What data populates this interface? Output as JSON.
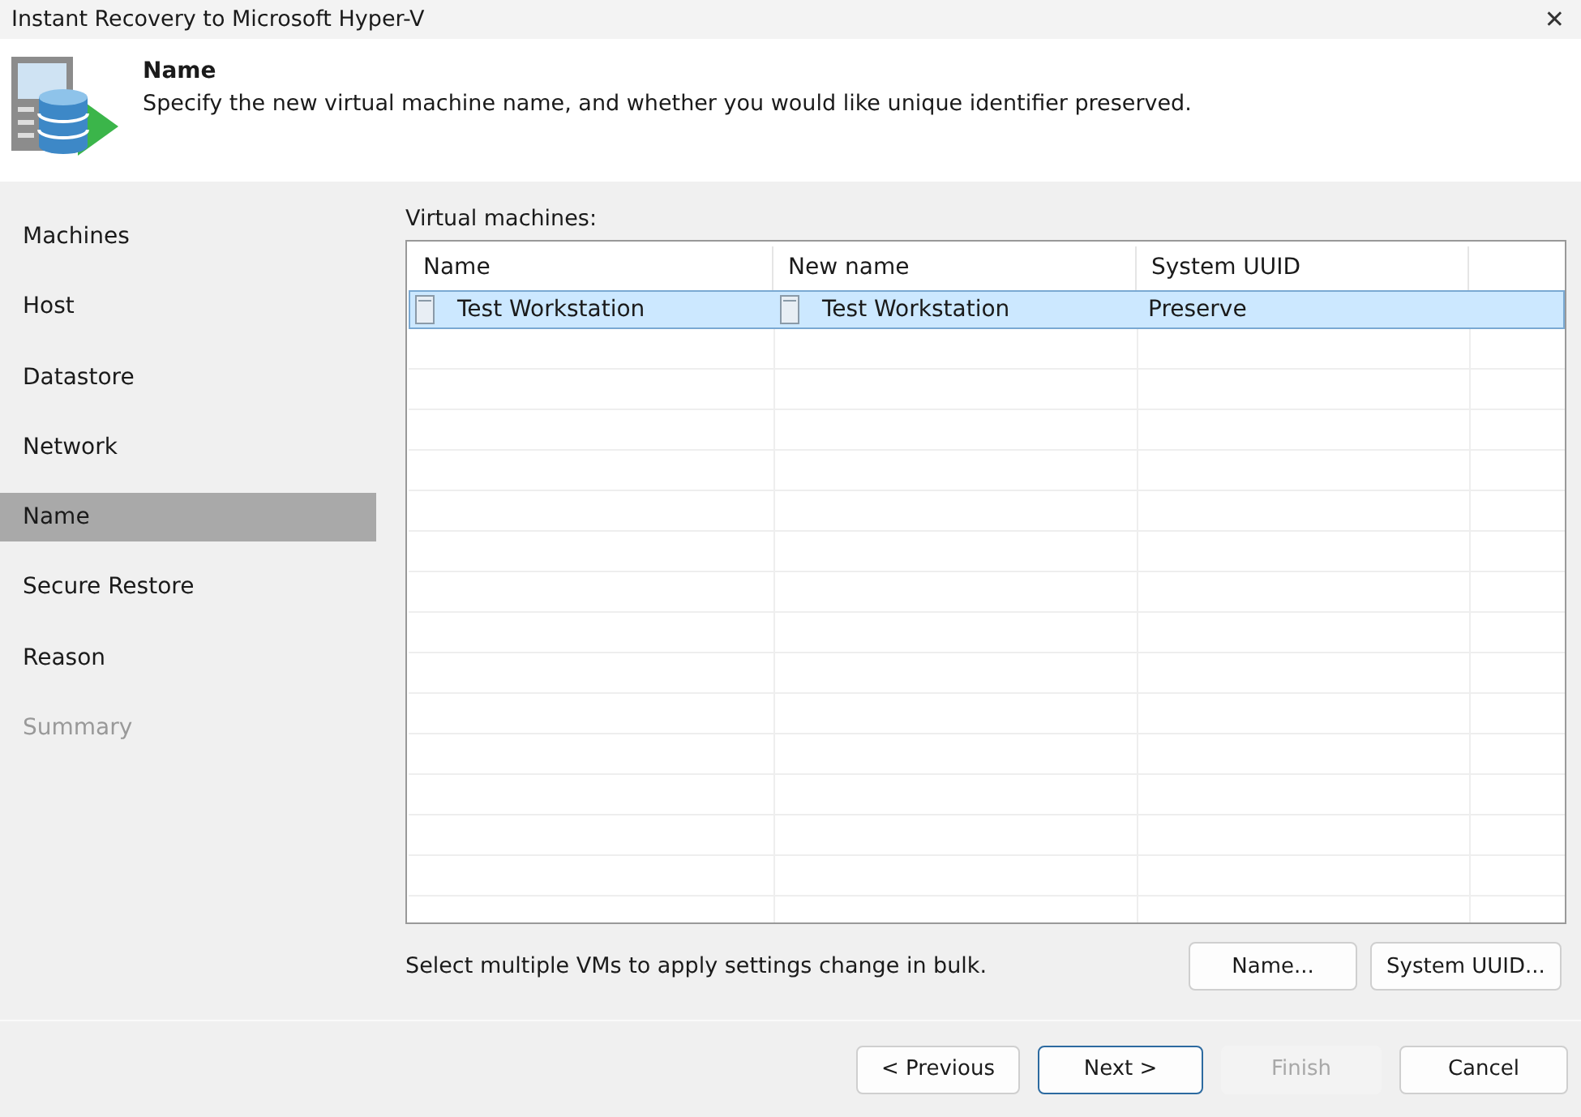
{
  "window": {
    "title": "Instant Recovery to Microsoft Hyper-V",
    "close": "✕"
  },
  "header": {
    "title": "Name",
    "description": "Specify the new virtual machine name, and whether you would like unique identifier preserved."
  },
  "steps": [
    {
      "label": "Machines",
      "selected": false,
      "disabled": false
    },
    {
      "label": "Host",
      "selected": false,
      "disabled": false
    },
    {
      "label": "Datastore",
      "selected": false,
      "disabled": false
    },
    {
      "label": "Network",
      "selected": false,
      "disabled": false
    },
    {
      "label": "Name",
      "selected": true,
      "disabled": false
    },
    {
      "label": "Secure Restore",
      "selected": false,
      "disabled": false
    },
    {
      "label": "Reason",
      "selected": false,
      "disabled": false
    },
    {
      "label": "Summary",
      "selected": false,
      "disabled": true
    }
  ],
  "table": {
    "label": "Virtual machines:",
    "columns": [
      "Name",
      "New name",
      "System UUID"
    ],
    "rows": [
      {
        "cells": [
          "Test Workstation",
          "Test Workstation",
          "Preserve"
        ],
        "selected": true
      }
    ]
  },
  "hint": "Select multiple VMs to apply settings change in bulk.",
  "bulk_buttons": [
    "Name...",
    "System UUID..."
  ],
  "footer_buttons": [
    {
      "label": "< Previous",
      "disabled": false,
      "default": false
    },
    {
      "label": "Next >",
      "disabled": false,
      "default": true
    },
    {
      "label": "Finish",
      "disabled": true,
      "default": false
    },
    {
      "label": "Cancel",
      "disabled": false,
      "default": false
    }
  ]
}
